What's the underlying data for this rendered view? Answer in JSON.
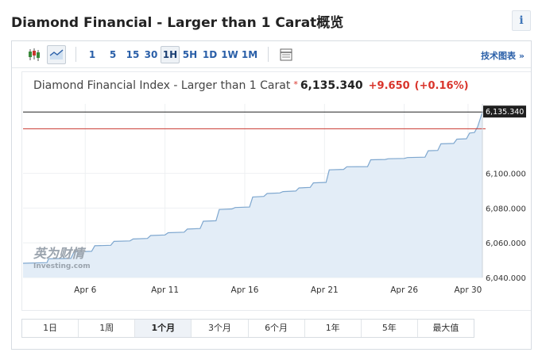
{
  "page": {
    "title": "Diamond Financial - Larger than 1 Carat概览"
  },
  "toolbar": {
    "intervals": [
      "1",
      "5",
      "15",
      "30",
      "1H",
      "5H",
      "1D",
      "1W",
      "1M"
    ],
    "active_interval": "1H",
    "tech_chart_link": "技术图表 »"
  },
  "quote": {
    "index_name": "Diamond Financial Index - Larger than 1 Carat",
    "star": "*",
    "last": "6,135.340",
    "change": "+9.650",
    "change_pct": "(+0.16%)"
  },
  "watermark": {
    "cn": "英为财情",
    "en": "Investing.com"
  },
  "ranges": [
    "1日",
    "1周",
    "1个月",
    "3个月",
    "6个月",
    "1年",
    "5年",
    "最大值"
  ],
  "active_range": "1个月",
  "colors": {
    "line": "#7ea7cf",
    "fill": "#e3edf7",
    "accent": "#2a5fa8",
    "down_line": "#c8362e",
    "up_text": "#d9342b"
  },
  "chart_data": {
    "type": "area",
    "title": "Diamond Financial Index - Larger than 1 Carat",
    "xlabel": "",
    "ylabel": "",
    "x_ticks": [
      {
        "label": "Apr 6",
        "day": 6
      },
      {
        "label": "Apr 11",
        "day": 11
      },
      {
        "label": "Apr 16",
        "day": 16
      },
      {
        "label": "Apr 21",
        "day": 21
      },
      {
        "label": "Apr 26",
        "day": 26
      },
      {
        "label": "Apr 30",
        "day": 30
      }
    ],
    "xlim": [
      2.1,
      30.9
    ],
    "y_ticks": [
      6040,
      6060,
      6080,
      6100
    ],
    "y_tick_labels": [
      "6,040.000",
      "6,060.000",
      "6,080.000",
      "6,100.000"
    ],
    "ylim": [
      6040,
      6140
    ],
    "last_value": 6135.34,
    "last_value_label": "6,135.340",
    "previous_close": 6125.69,
    "series": [
      {
        "values": [
          [
            2.1,
            6048.2
          ],
          [
            3.6,
            6048.6
          ],
          [
            3.7,
            6050.8
          ],
          [
            5.1,
            6051.0
          ],
          [
            5.3,
            6054.8
          ],
          [
            6.4,
            6055.1
          ],
          [
            6.6,
            6058.3
          ],
          [
            7.6,
            6058.6
          ],
          [
            7.8,
            6060.8
          ],
          [
            8.8,
            6061.1
          ],
          [
            9.0,
            6062.2
          ],
          [
            9.9,
            6062.5
          ],
          [
            10.1,
            6064.2
          ],
          [
            11.0,
            6064.5
          ],
          [
            11.2,
            6065.8
          ],
          [
            12.2,
            6066.1
          ],
          [
            12.4,
            6067.9
          ],
          [
            13.2,
            6068.2
          ],
          [
            13.4,
            6072.4
          ],
          [
            14.2,
            6072.7
          ],
          [
            14.4,
            6079.2
          ],
          [
            15.2,
            6079.5
          ],
          [
            15.4,
            6080.3
          ],
          [
            16.3,
            6080.6
          ],
          [
            16.5,
            6086.4
          ],
          [
            17.2,
            6086.7
          ],
          [
            17.4,
            6088.4
          ],
          [
            18.2,
            6088.7
          ],
          [
            18.4,
            6089.5
          ],
          [
            19.2,
            6089.8
          ],
          [
            19.4,
            6091.6
          ],
          [
            20.1,
            6091.9
          ],
          [
            20.3,
            6094.5
          ],
          [
            21.1,
            6094.8
          ],
          [
            21.3,
            6102.0
          ],
          [
            22.2,
            6102.3
          ],
          [
            22.4,
            6103.8
          ],
          [
            23.7,
            6103.9
          ],
          [
            23.9,
            6107.8
          ],
          [
            24.8,
            6108.0
          ],
          [
            25.0,
            6108.4
          ],
          [
            26.0,
            6108.6
          ],
          [
            26.2,
            6109.1
          ],
          [
            27.3,
            6109.3
          ],
          [
            27.5,
            6113.0
          ],
          [
            28.1,
            6113.2
          ],
          [
            28.3,
            6117.0
          ],
          [
            29.1,
            6117.2
          ],
          [
            29.3,
            6119.7
          ],
          [
            29.9,
            6119.9
          ],
          [
            30.1,
            6123.2
          ],
          [
            30.4,
            6123.5
          ],
          [
            30.6,
            6126.8
          ],
          [
            30.9,
            6135.3
          ]
        ]
      }
    ]
  }
}
